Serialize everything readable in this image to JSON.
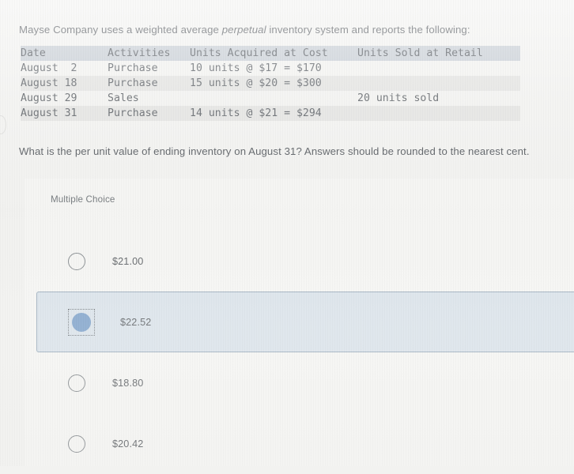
{
  "intro": {
    "before": "Mayse Company uses a weighted average ",
    "emphasis": "perpetual",
    "after": " inventory system and reports the following:"
  },
  "table": {
    "headers": [
      "Date",
      "Activities",
      "Units Acquired at Cost",
      "Units Sold at Retail"
    ],
    "rows": [
      {
        "date": "August  2",
        "activity": "Purchase",
        "acquired": "10 units @ $17 = $170",
        "sold": ""
      },
      {
        "date": "August 18",
        "activity": "Purchase",
        "acquired": "15 units @ $20 = $300",
        "sold": ""
      },
      {
        "date": "August 29",
        "activity": "Sales",
        "acquired": "",
        "sold": "20 units sold"
      },
      {
        "date": "August 31",
        "activity": "Purchase",
        "acquired": "14 units @ $21 = $294",
        "sold": ""
      }
    ]
  },
  "question": "What is the per unit value of ending inventory on August 31? Answers should be rounded to the nearest cent.",
  "answer": {
    "kind_label": "Multiple Choice",
    "options": [
      {
        "label": "$21.00",
        "selected": false
      },
      {
        "label": "$22.52",
        "selected": true
      },
      {
        "label": "$18.80",
        "selected": false
      },
      {
        "label": "$20.42",
        "selected": false
      }
    ],
    "selected_color": "#6a94c4",
    "selected_row_bg": "#d6e1ea",
    "selected_row_border": "#8ba0b3"
  }
}
